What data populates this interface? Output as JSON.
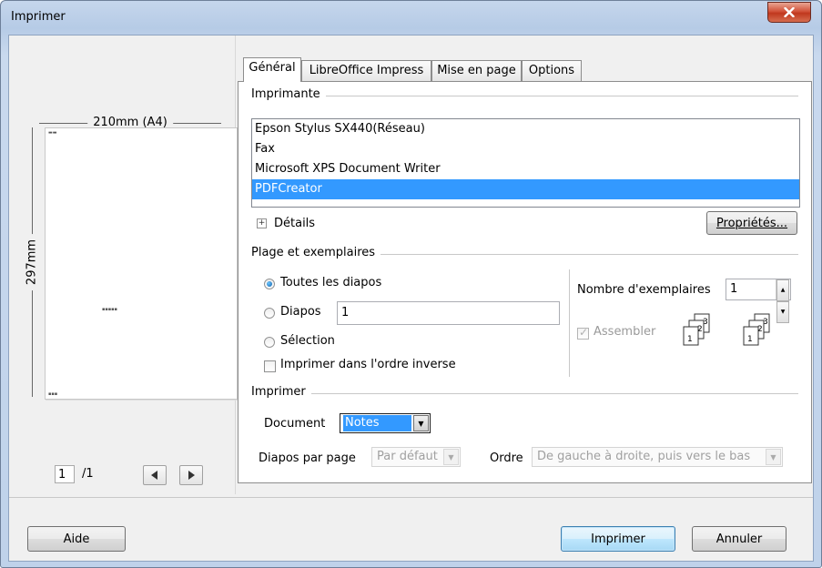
{
  "window": {
    "title": "Imprimer"
  },
  "preview": {
    "width_label": "210mm (A4)",
    "height_label": "297mm",
    "page_current": "1",
    "page_total": "/1"
  },
  "tabs": [
    {
      "label": "Général",
      "active": true
    },
    {
      "label": "LibreOffice Impress",
      "active": false
    },
    {
      "label": "Mise en page",
      "active": false
    },
    {
      "label": "Options",
      "active": false
    }
  ],
  "printer": {
    "section": "Imprimante",
    "items": [
      "Epson Stylus SX440(Réseau)",
      "Fax",
      "Microsoft XPS Document Writer",
      "PDFCreator"
    ],
    "selected": "PDFCreator",
    "details_label": "Détails",
    "properties_button": "Propriétés..."
  },
  "range": {
    "section": "Plage et exemplaires",
    "all_slides": "Toutes les diapos",
    "slides": "Diapos",
    "slides_value": "1",
    "selection": "Sélection",
    "reverse_order": "Imprimer dans l'ordre inverse",
    "copies_label": "Nombre d'exemplaires",
    "copies_value": "1",
    "collate": "Assembler"
  },
  "print": {
    "section": "Imprimer",
    "document_label": "Document",
    "document_value": "Notes",
    "per_page_label": "Diapos par page",
    "per_page_value": "Par défaut",
    "order_label": "Ordre",
    "order_value": "De gauche à droite, puis vers le bas"
  },
  "buttons": {
    "help": "Aide",
    "print": "Imprimer",
    "cancel": "Annuler"
  },
  "colors": {
    "selection": "#3399ff",
    "close_button": "#c7452a"
  }
}
